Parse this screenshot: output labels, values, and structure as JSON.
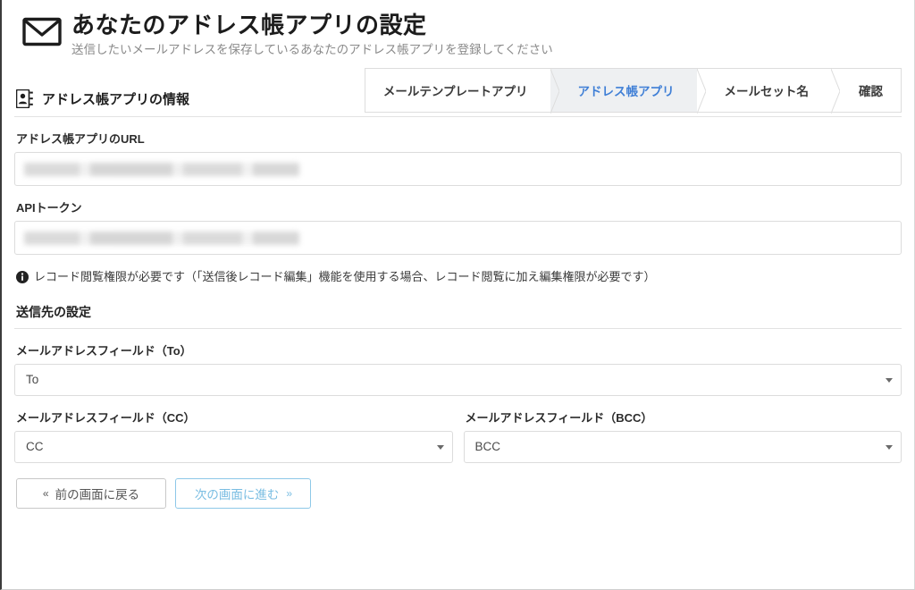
{
  "header": {
    "icon": "envelope-icon",
    "title": "あなたのアドレス帳アプリの設定",
    "subtitle": "送信したいメールアドレスを保存しているあなたのアドレス帳アプリを登録してください"
  },
  "steps": [
    {
      "label": "メールテンプレートアプリ",
      "active": false
    },
    {
      "label": "アドレス帳アプリ",
      "active": true
    },
    {
      "label": "メールセット名",
      "active": false
    },
    {
      "label": "確認",
      "active": false
    }
  ],
  "section": {
    "icon": "address-book-icon",
    "title": "アドレス帳アプリの情報"
  },
  "fields": {
    "url_label": "アドレス帳アプリのURL",
    "url_value": "",
    "token_label": "APIトークン",
    "token_value": ""
  },
  "notice": {
    "icon": "info-icon",
    "text": "レコード閲覧権限が必要です（「送信後レコード編集」機能を使用する場合、レコード閲覧に加え編集権限が必要です）"
  },
  "destination": {
    "title": "送信先の設定",
    "to": {
      "label": "メールアドレスフィールド（To）",
      "value": "To"
    },
    "cc": {
      "label": "メールアドレスフィールド（CC）",
      "value": "CC"
    },
    "bcc": {
      "label": "メールアドレスフィールド（BCC）",
      "value": "BCC"
    }
  },
  "buttons": {
    "back_arrows": "«",
    "back_label": "前の画面に戻る",
    "next_label": "次の画面に進む",
    "next_arrows": "»"
  },
  "colors": {
    "active_step_text": "#3f7fd6",
    "active_step_bg": "#eef0f2",
    "next_button": "#79bde2",
    "border": "#dcdcdc"
  }
}
